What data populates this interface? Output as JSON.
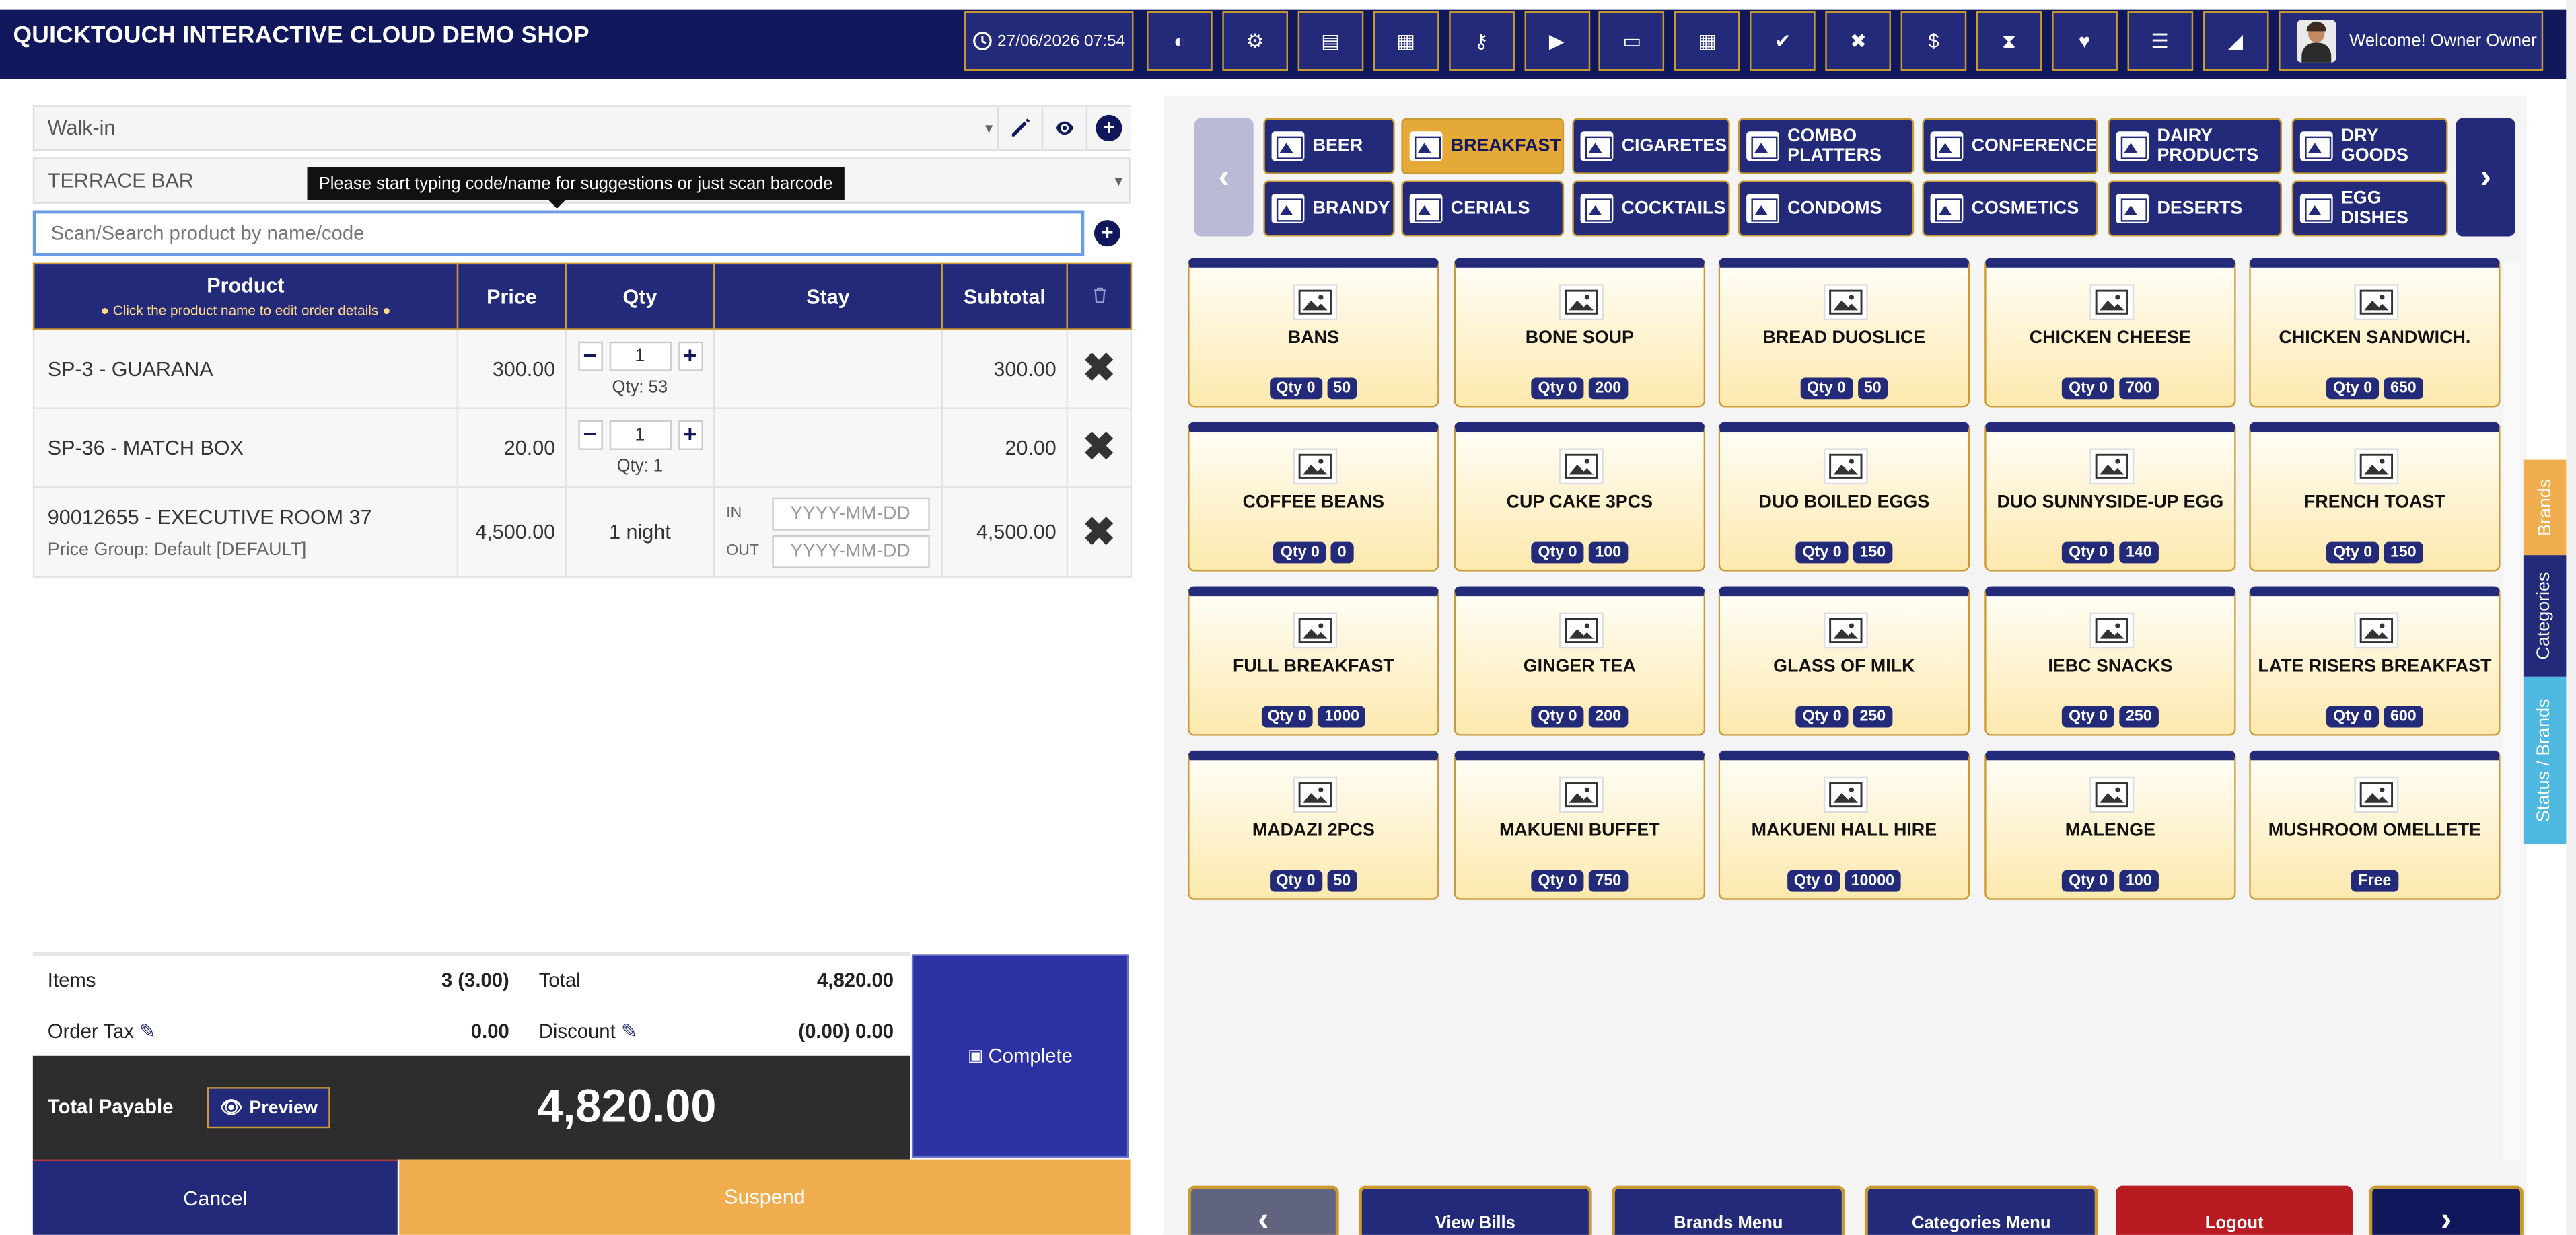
{
  "header": {
    "shop_title": "QUICKTOUCH INTERACTIVE CLOUD DEMO SHOP",
    "datetime": "27/06/2026 07:54",
    "welcome": "Welcome! Owner Owner",
    "icons": [
      "dashboard-icon",
      "settings-icon",
      "register-icon",
      "calculator-icon",
      "key-icon",
      "play-icon",
      "laptop-icon",
      "grid-icon",
      "check-icon",
      "cancel-icon",
      "dollar-icon",
      "hourglass-icon",
      "heart-icon",
      "list-icon",
      "eraser-icon"
    ]
  },
  "customer": {
    "value": "Walk-in"
  },
  "table_select": {
    "value": "TERRACE BAR"
  },
  "tooltip": "Please start typing code/name for suggestions or just scan barcode",
  "search": {
    "placeholder": "Scan/Search product by name/code"
  },
  "order_table": {
    "headers": {
      "product": "Product",
      "product_hint": "Click the product name to edit order details",
      "price": "Price",
      "qty": "Qty",
      "stay": "Stay",
      "subtotal": "Subtotal"
    },
    "rows": [
      {
        "product": "SP-3 - GUARANA",
        "price": "300.00",
        "qty": "1",
        "qty_note": "Qty: 53",
        "subtotal": "300.00"
      },
      {
        "product": "SP-36 - MATCH BOX",
        "price": "20.00",
        "qty": "1",
        "qty_note": "Qty: 1",
        "subtotal": "20.00"
      },
      {
        "product": "90012655 - EXECUTIVE ROOM 37",
        "price_group": "Price Group: Default [DEFAULT]",
        "price": "4,500.00",
        "qty_text": "1 night",
        "stay_in_label": "IN",
        "stay_out_label": "OUT",
        "date_placeholder": "YYYY-MM-DD",
        "subtotal": "4,500.00"
      }
    ]
  },
  "totals": {
    "items_label": "Items",
    "items_value": "3 (3.00)",
    "total_label": "Total",
    "total_value": "4,820.00",
    "tax_label": "Order Tax",
    "tax_value": "0.00",
    "discount_label": "Discount",
    "discount_value": "(0.00) 0.00",
    "payable_label": "Total Payable",
    "preview_label": "Preview",
    "payable_value": "4,820.00"
  },
  "actions": {
    "complete": "Complete",
    "cancel": "Cancel",
    "suspend": "Suspend"
  },
  "categories": [
    [
      "BEER",
      "BREAKFAST",
      "CIGARETES",
      "COMBO PLATTERS",
      "CONFERENCE",
      "DAIRY PRODUCTS",
      "DRY GOODS"
    ],
    [
      "BRANDY",
      "CERIALS",
      "COCKTAILS",
      "CONDOMS",
      "COSMETICS",
      "DESERTS",
      "EGG DISHES"
    ]
  ],
  "active_category": "BREAKFAST",
  "products": [
    {
      "name": "BANS",
      "qty": "Qty 0",
      "price": "50"
    },
    {
      "name": "BONE SOUP",
      "qty": "Qty 0",
      "price": "200"
    },
    {
      "name": "BREAD DUOSLICE",
      "qty": "Qty 0",
      "price": "50"
    },
    {
      "name": "CHICKEN CHEESE",
      "qty": "Qty 0",
      "price": "700"
    },
    {
      "name": "CHICKEN SANDWICH.",
      "qty": "Qty 0",
      "price": "650"
    },
    {
      "name": "COFFEE BEANS",
      "qty": "Qty 0",
      "price": "0"
    },
    {
      "name": "CUP CAKE 3PCS",
      "qty": "Qty 0",
      "price": "100"
    },
    {
      "name": "DUO BOILED EGGS",
      "qty": "Qty 0",
      "price": "150"
    },
    {
      "name": "DUO SUNNYSIDE-UP EGG",
      "qty": "Qty 0",
      "price": "140"
    },
    {
      "name": "FRENCH TOAST",
      "qty": "Qty 0",
      "price": "150"
    },
    {
      "name": "FULL BREAKFAST",
      "qty": "Qty 0",
      "price": "1000"
    },
    {
      "name": "GINGER TEA",
      "qty": "Qty 0",
      "price": "200"
    },
    {
      "name": "GLASS OF MILK",
      "qty": "Qty 0",
      "price": "250"
    },
    {
      "name": "IEBC SNACKS",
      "qty": "Qty 0",
      "price": "250"
    },
    {
      "name": "LATE RISERS BREAKFAST",
      "qty": "Qty 0",
      "price": "600"
    },
    {
      "name": "MADAZI 2PCS",
      "qty": "Qty 0",
      "price": "50"
    },
    {
      "name": "MAKUENI BUFFET",
      "qty": "Qty 0",
      "price": "750"
    },
    {
      "name": "MAKUENI HALL HIRE",
      "qty": "Qty 0",
      "price": "10000"
    },
    {
      "name": "MALENGE",
      "qty": "Qty 0",
      "price": "100"
    },
    {
      "name": "MUSHROOM OMELLETE",
      "qty": "",
      "price": "Free"
    }
  ],
  "side_tabs": {
    "brands": "Brands",
    "categories": "Categories",
    "status_brands": "Status / Brands"
  },
  "bottom_bar": {
    "view_bills": "View Bills",
    "brands_menu": "Brands Menu",
    "categories_menu": "Categories Menu",
    "logout": "Logout"
  },
  "colors": {
    "navy": "#232a7a",
    "gold": "#e4a936",
    "complete": "#2c32a4",
    "suspend": "#f0ad4e",
    "logout": "#b81c22"
  }
}
